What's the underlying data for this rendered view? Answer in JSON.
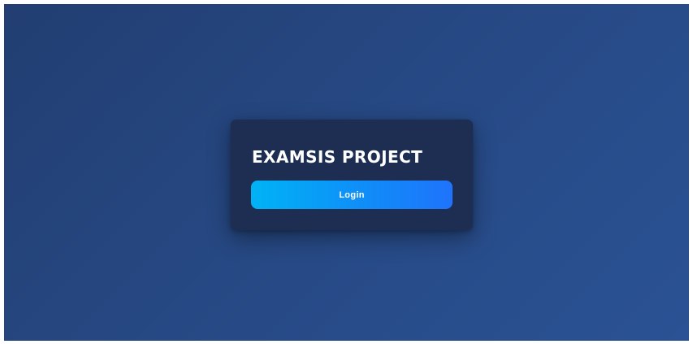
{
  "login_card": {
    "title": "EXAMSIS PROJECT",
    "login_label": "Login"
  },
  "colors": {
    "background_start": "#223e72",
    "background_end": "#2a5294",
    "card": "#1d2e52",
    "button_start": "#00b3f5",
    "button_end": "#1f73fb",
    "text": "#ffffff"
  }
}
